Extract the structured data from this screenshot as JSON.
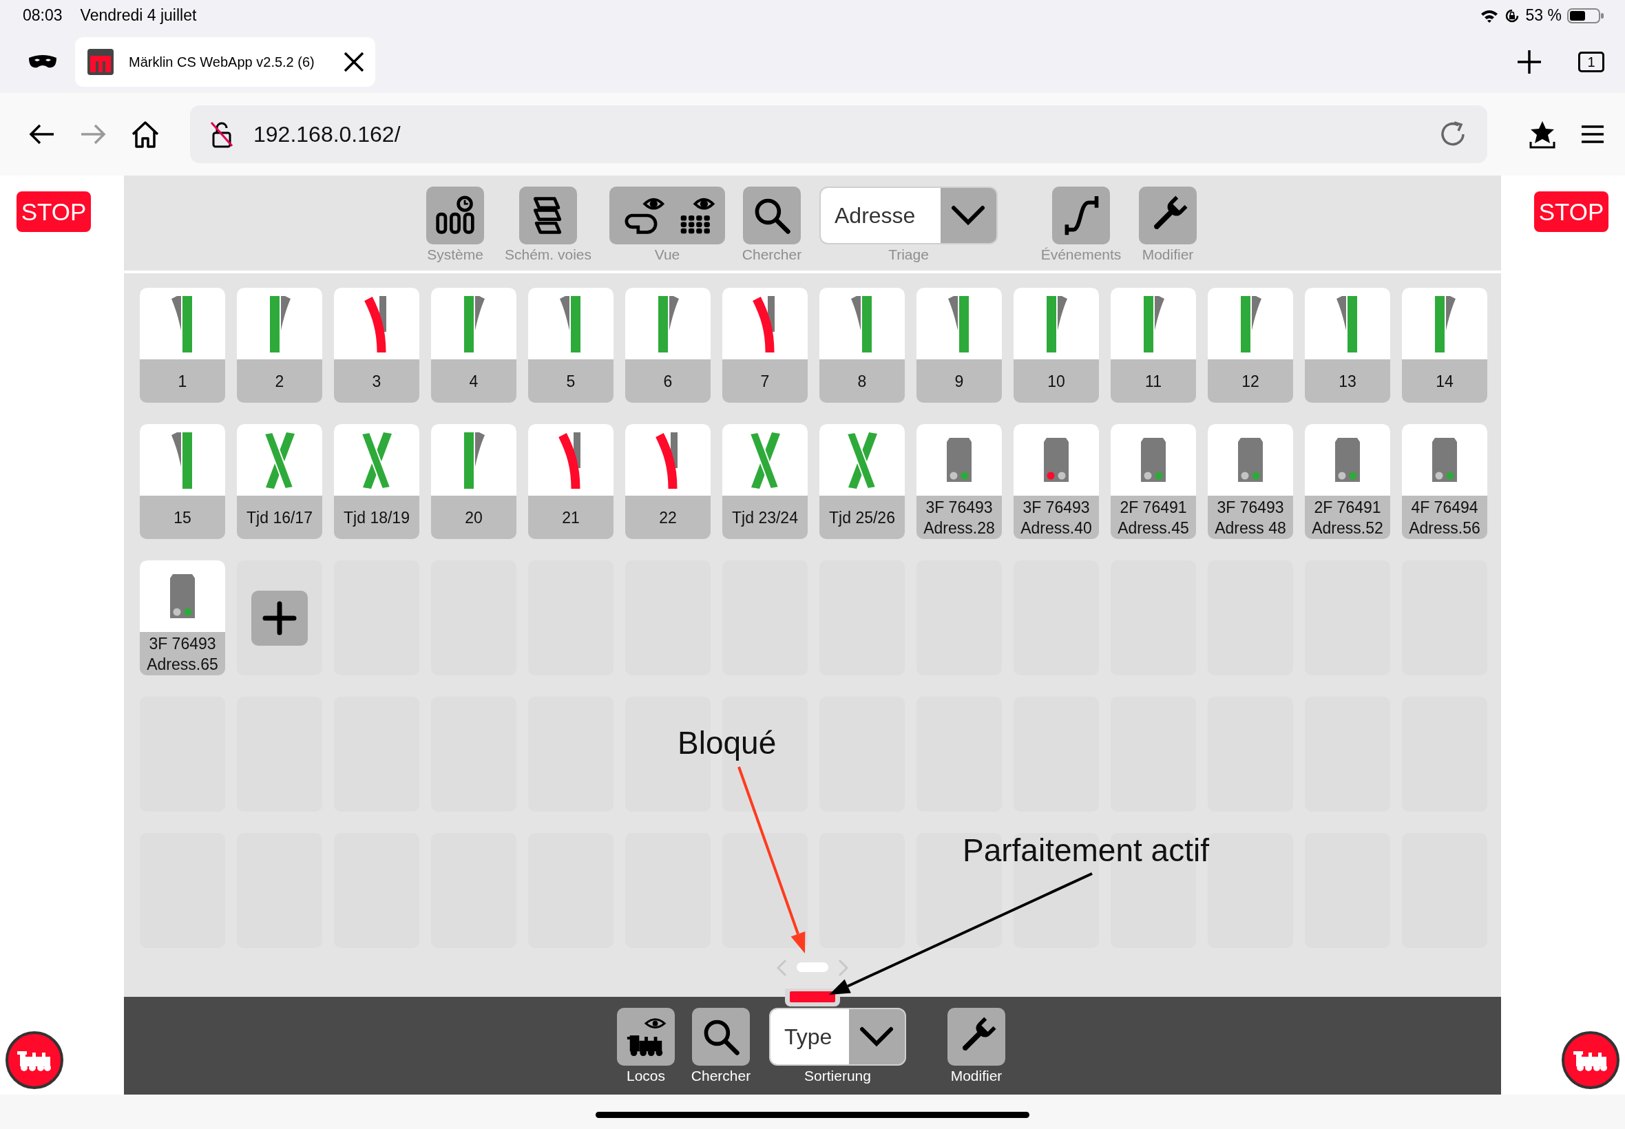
{
  "status_bar": {
    "time": "08:03",
    "date": "Vendredi 4 juillet",
    "battery": "53 %"
  },
  "browser": {
    "tab_title": "Märklin CS WebApp v2.5.2 (6)",
    "tab_count": "1",
    "url": "192.168.0.162/",
    "forward_enabled": false
  },
  "stop_buttons": [
    "STOP",
    "STOP"
  ],
  "toolbar": [
    {
      "kind": "system",
      "label": "Système"
    },
    {
      "kind": "layout",
      "label": "Schém. voies"
    },
    {
      "kind": "view",
      "label": "Vue"
    },
    {
      "kind": "search",
      "label": "Chercher"
    },
    {
      "kind": "sort",
      "label": "Triage",
      "value": "Adresse"
    },
    {
      "kind": "events",
      "label": "Événements"
    },
    {
      "kind": "edit",
      "label": "Modifier"
    }
  ],
  "tiles": [
    {
      "kind": "switch",
      "label": "1",
      "right_hand": false,
      "thrown": false
    },
    {
      "kind": "switch",
      "label": "2",
      "right_hand": true,
      "thrown": false
    },
    {
      "kind": "switch",
      "label": "3",
      "right_hand": false,
      "thrown": true
    },
    {
      "kind": "switch",
      "label": "4",
      "right_hand": true,
      "thrown": false
    },
    {
      "kind": "switch",
      "label": "5",
      "right_hand": false,
      "thrown": false
    },
    {
      "kind": "switch",
      "label": "6",
      "right_hand": true,
      "thrown": false
    },
    {
      "kind": "switch",
      "label": "7",
      "right_hand": false,
      "thrown": true
    },
    {
      "kind": "switch",
      "label": "8",
      "right_hand": false,
      "thrown": false
    },
    {
      "kind": "switch",
      "label": "9",
      "right_hand": false,
      "thrown": false
    },
    {
      "kind": "switch",
      "label": "10",
      "right_hand": true,
      "thrown": false
    },
    {
      "kind": "switch",
      "label": "11",
      "right_hand": true,
      "thrown": false
    },
    {
      "kind": "switch",
      "label": "12",
      "right_hand": true,
      "thrown": false
    },
    {
      "kind": "switch",
      "label": "13",
      "right_hand": false,
      "thrown": false
    },
    {
      "kind": "switch",
      "label": "14",
      "right_hand": true,
      "thrown": false
    },
    {
      "kind": "switch",
      "label": "15",
      "right_hand": false,
      "thrown": false
    },
    {
      "kind": "crossing",
      "label": "Tjd 16/17"
    },
    {
      "kind": "crossing",
      "label": "Tjd 18/19"
    },
    {
      "kind": "switch",
      "label": "20",
      "right_hand": true,
      "thrown": false
    },
    {
      "kind": "switch",
      "label": "21",
      "right_hand": false,
      "thrown": true
    },
    {
      "kind": "switch",
      "label": "22",
      "right_hand": false,
      "thrown": true
    },
    {
      "kind": "crossing",
      "label": "Tjd 23/24"
    },
    {
      "kind": "crossing",
      "label": "Tjd 25/26"
    },
    {
      "kind": "signal",
      "label": "3F 76493",
      "address": "Adress.28",
      "stop": false
    },
    {
      "kind": "signal",
      "label": "3F 76493",
      "address": "Adress.40",
      "stop": true
    },
    {
      "kind": "signal",
      "label": "2F 76491",
      "address": "Adress.45",
      "stop": false
    },
    {
      "kind": "signal",
      "label": "3F 76493",
      "address": "Adress 48",
      "stop": false
    },
    {
      "kind": "signal",
      "label": "2F 76491",
      "address": "Adress.52",
      "stop": false
    },
    {
      "kind": "signal",
      "label": "4F 76494",
      "address": "Adress.56",
      "stop": false
    },
    {
      "kind": "signal",
      "label": "3F 76493",
      "address": "Adress.65",
      "stop": false
    },
    {
      "kind": "add"
    }
  ],
  "bottom_bar": [
    {
      "kind": "locos",
      "label": "Locos"
    },
    {
      "kind": "search",
      "label": "Chercher"
    },
    {
      "kind": "sort",
      "label": "Sortierung",
      "value": "Type"
    },
    {
      "kind": "edit",
      "label": "Modifier"
    }
  ],
  "annotations": [
    {
      "text": "Bloqué",
      "color": "#ff3b1f"
    },
    {
      "text": "Parfaitement actif",
      "color": "#000000"
    }
  ]
}
